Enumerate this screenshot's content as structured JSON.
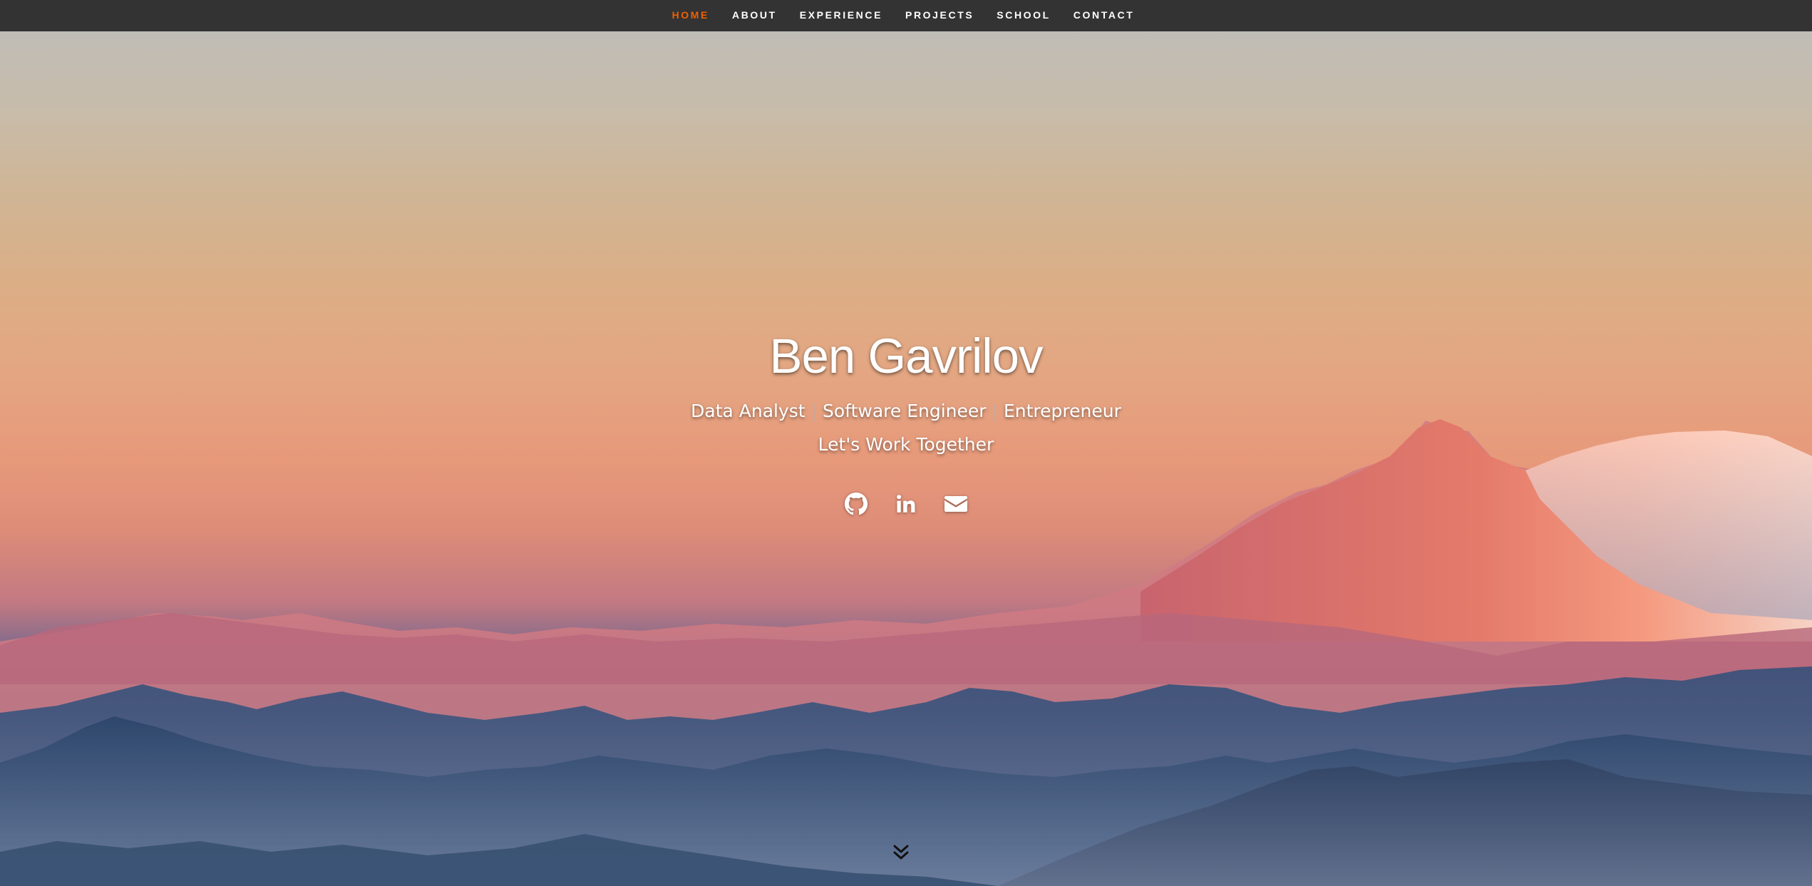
{
  "nav": {
    "items": [
      {
        "label": "HOME",
        "active": true
      },
      {
        "label": "ABOUT",
        "active": false
      },
      {
        "label": "EXPERIENCE",
        "active": false
      },
      {
        "label": "PROJECTS",
        "active": false
      },
      {
        "label": "SCHOOL",
        "active": false
      },
      {
        "label": "CONTACT",
        "active": false
      }
    ],
    "background_color": "#333333",
    "active_color": "#f06000"
  },
  "banner": {
    "name": "Ben Gavrilov",
    "roles": [
      "Data Analyst",
      "Software Engineer",
      "Entrepreneur"
    ],
    "separator": "|",
    "cta": "Let's Work Together"
  },
  "social": [
    {
      "icon": "github-icon"
    },
    {
      "icon": "linkedin-icon"
    },
    {
      "icon": "envelope-icon"
    }
  ],
  "scroll_icon": "double-chevron-down-icon"
}
